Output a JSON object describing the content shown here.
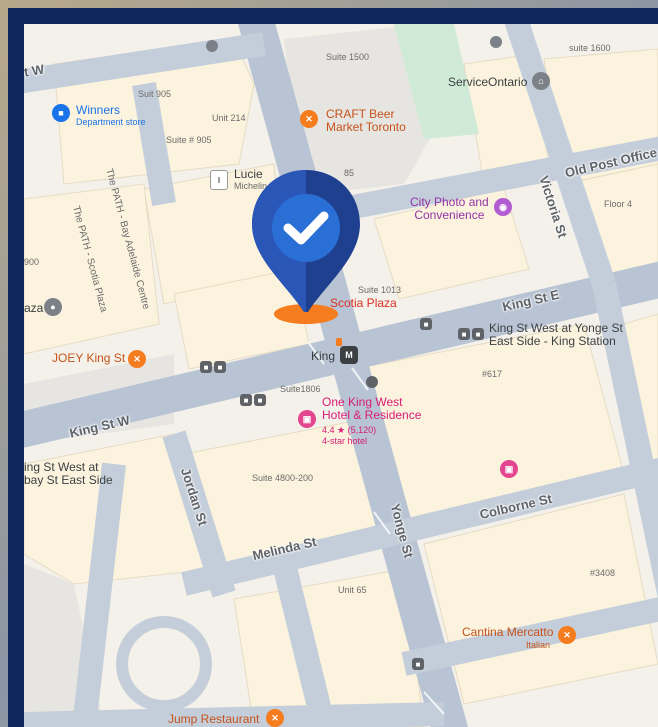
{
  "map": {
    "roads": [
      {
        "name": "King St W",
        "id": "king-st-w"
      },
      {
        "name": "King St E",
        "id": "king-st-e"
      },
      {
        "name": "Yonge St",
        "id": "yonge-st"
      },
      {
        "name": "Victoria St",
        "id": "victoria-st"
      },
      {
        "name": "Jordan St",
        "id": "jordan-st"
      },
      {
        "name": "Melinda St",
        "id": "melinda-st"
      },
      {
        "name": "Colborne St",
        "id": "colborne-st"
      },
      {
        "name": "Old Post Office",
        "id": "old-post-office"
      },
      {
        "name": "Adelaide St W",
        "id": "adelaide-st-w-fragment",
        "visible_text": "t W"
      }
    ],
    "places": {
      "winners": {
        "name": "Winners",
        "sub": "Department store"
      },
      "craft": {
        "name": "CRAFT Beer\nMarket Toronto"
      },
      "service_ontario": {
        "name": "ServiceOntario"
      },
      "lucie": {
        "name": "Lucie",
        "sub": "Michelin"
      },
      "city_photo": {
        "name": "City Photo and\nConvenience"
      },
      "scotia_plaza": {
        "name": "Scotia Plaza"
      },
      "joey": {
        "name": "JOEY King St"
      },
      "king_station_stop": {
        "name": "King St West at Yonge St\nEast Side - King Station"
      },
      "king_station": {
        "name": "King"
      },
      "one_king": {
        "name": "One King West\nHotel & Residence",
        "rating": "4.4 ★ (5,120)",
        "sub": "4-star hotel"
      },
      "bay_stop": {
        "name": "ing St West at\nbay St East Side"
      },
      "cantina": {
        "name": "Cantina Mercatto",
        "sub": "Italian"
      },
      "jump": {
        "name": "Jump Restaurant"
      },
      "path_bay": {
        "name": "The PATH - Bay Adelaide Centre"
      },
      "path_scotia": {
        "name": "The PATH - Scotia Plaza"
      },
      "plaza_left": {
        "name": "aza"
      },
      "num_900": {
        "name": "900"
      }
    },
    "buildings": {
      "suite_1500": "Suite 1500",
      "suite_1600": "suite 1600",
      "suit_905": "Suit 905",
      "unit_214": "Unit 214",
      "suite_905b": "Suite # 905",
      "num_85": "85",
      "floor_4": "Floor 4",
      "suite_1013": "Suite 1013",
      "num_617": "#617",
      "suite_1806": "Suite1806",
      "suite_4800": "Suite 4800-200",
      "unit_65": "Unit 65",
      "num_3408": "#3408"
    },
    "marker": {
      "icon": "check-icon",
      "colors": {
        "outer": "#1f3f8f",
        "inner": "#2a6fd6",
        "base": "#f57c1f"
      }
    }
  }
}
